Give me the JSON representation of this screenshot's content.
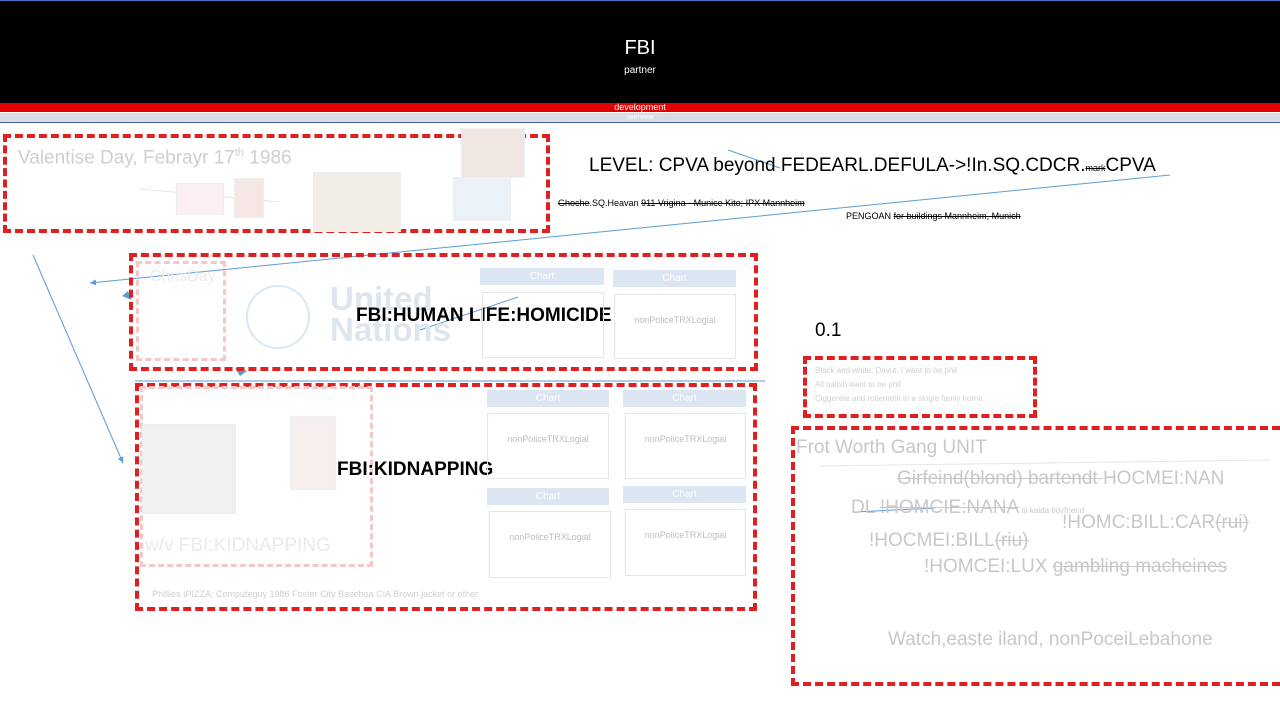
{
  "header": {
    "title": "FBI",
    "subtitle": "partner"
  },
  "bars": {
    "red": "development",
    "grey": "overview"
  },
  "valentine": {
    "title_main": "Valentise Day, Febrayr 17",
    "title_sup": "th",
    "title_tail": " 1986",
    "question": "?"
  },
  "level_line": {
    "prefix": "LEVEL: CPVA beyond FEDEARL.DEFULA->!In.SQ.CDCR.",
    "struck": "mark",
    "suffix": "CPVA"
  },
  "sub_line_1": {
    "struck1": "Ghoche",
    "mid": ".SQ.Heavan ",
    "struck2": "911 Vrigina - Munice Kito; IPX Mannheim"
  },
  "sub_line_2": {
    "text": "PENGOAN ",
    "struck": "for buildings Mannheim, Munich"
  },
  "homicide": {
    "label": "FBI:HUMAN LIFE:HOMICIDE",
    "ghost_label": "ChrisDay",
    "un_logo_text_1": "United",
    "un_logo_text_2": "Nations",
    "charts": [
      {
        "header": "Chart",
        "body": ""
      },
      {
        "header": "Chart",
        "body": "nonPoliceTRXLogial"
      }
    ]
  },
  "value": "0.1",
  "note_box": {
    "lines": [
      "Black and white; Davut, I want to be phil",
      "All tukish want to be phil",
      "Ciggerete and rotiemetn in a single famly home"
    ]
  },
  "kidnapping": {
    "label": "FBI:KIDNAPPING",
    "ghost_label": "w/v FBI:KIDNAPPING",
    "footer": "Phillies IPIZZA: Computeguy 1986 Foster City Baseboa CIA Brown jacket or other",
    "charts": [
      {
        "header": "Chart",
        "body": "nonPoliceTRXLogial"
      },
      {
        "header": "Chart",
        "body": "nonPoliceTRXLogial"
      },
      {
        "header": "Chart",
        "body": "nonPoliceTRXLogial"
      },
      {
        "header": "Chart",
        "body": "nonPoliceTRXLogial"
      }
    ]
  },
  "gang": {
    "title": "Frot Worth Gang UNIT",
    "line1_struck": "Girfeind(blond) bartendt ",
    "line1_tail": "HOCMEI:NAN",
    "line2_prefix": "DL ",
    "line2_struck": "!HOMCIE:NANA",
    "line2_small": " al kaida boyfriend",
    "line3_main": "!HOMC:BILL:CAR",
    "line3_struck": "(rui)",
    "line4_main": "!HOCMEI:BILL",
    "line4_struck": "(riu)",
    "line5_main": "!HOMCEI:LUX ",
    "line5_struck": "gambling macheines",
    "line6": "Watch,easte iland, nonPoceiLebahone"
  },
  "colors": {
    "accent_red": "#e02020",
    "header_bg": "#000000",
    "arrow": "#5b9bd5"
  }
}
